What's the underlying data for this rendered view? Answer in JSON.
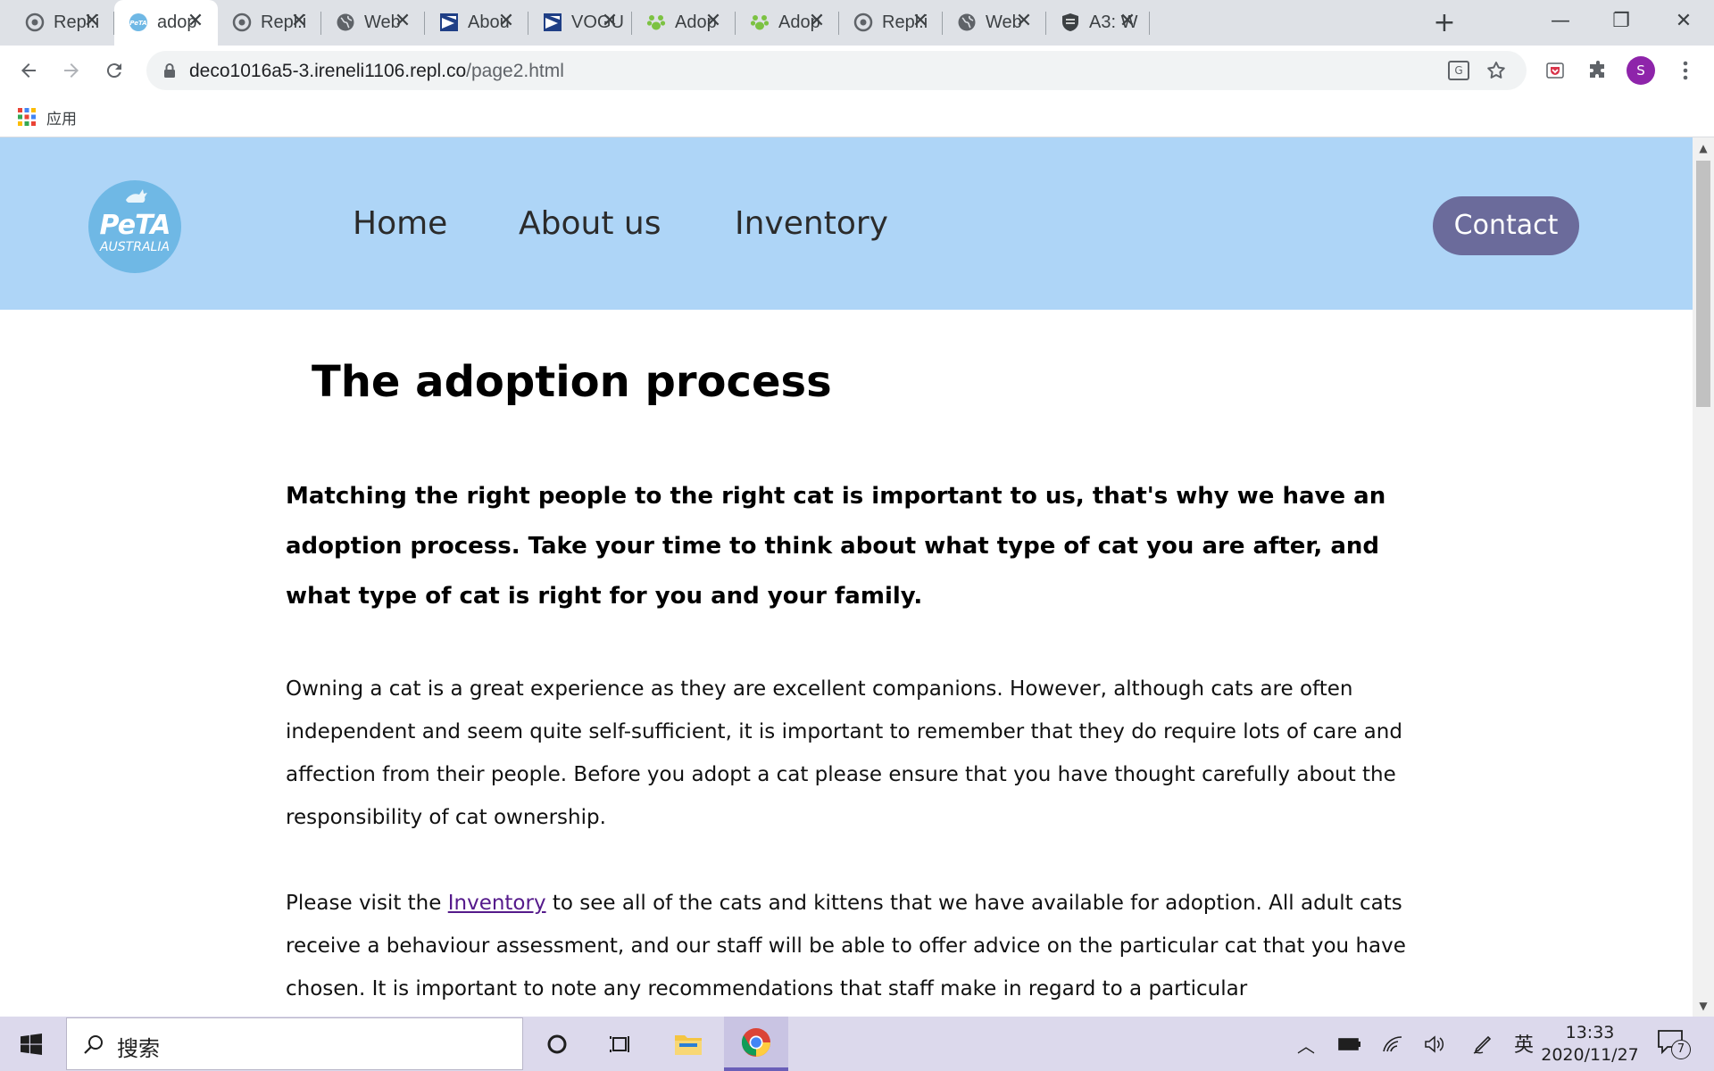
{
  "browser": {
    "tabs": [
      {
        "title": "Repl.i",
        "icon": "replit-icon"
      },
      {
        "title": "adop",
        "icon": "peta-icon",
        "active": true
      },
      {
        "title": "Repl.i",
        "icon": "replit-icon"
      },
      {
        "title": "Web",
        "icon": "globe-icon"
      },
      {
        "title": "Abou",
        "icon": "banner-icon"
      },
      {
        "title": "VOGU",
        "icon": "banner-icon"
      },
      {
        "title": "Adop",
        "icon": "paw-icon"
      },
      {
        "title": "Adop",
        "icon": "paw-icon"
      },
      {
        "title": "Repl.i",
        "icon": "replit-icon"
      },
      {
        "title": "Web",
        "icon": "globe-icon"
      },
      {
        "title": "A3: W",
        "icon": "shield-icon"
      }
    ],
    "url_host": "deco1016a5-3.ireneli1106.repl.co",
    "url_path": "/page2.html",
    "bookmarks_apps_label": "应用",
    "profile_initial": "S"
  },
  "site": {
    "logo_text": "PeTA",
    "logo_sub": "AUSTRALIA",
    "nav": {
      "home": "Home",
      "about": "About us",
      "inventory": "Inventory"
    },
    "contact": "Contact",
    "title": "The adoption process",
    "lead": "Matching the right people to the right cat is important to us, that's why we have an adoption process. Take your time to think about what type of cat you are after, and what type of cat is right for you and your family.",
    "para1": "Owning a cat is a great experience as they are excellent companions. However, although cats are often independent and seem quite self-sufficient, it is important to remember that they do require lots of care and affection from their people. Before you adopt a cat please ensure that you have thought carefully about the responsibility of cat ownership.",
    "para2_before": "Please visit the ",
    "para2_link": "Inventory",
    "para2_after": " to see all of the cats and kittens that we have available for adoption. All adult cats receive a behaviour assessment, and our staff will be able to offer advice on the particular cat that you have chosen. It is important to note any recommendations that staff make in regard to a particular"
  },
  "taskbar": {
    "search_placeholder": "搜索",
    "ime": "英",
    "time": "13:33",
    "date": "2020/11/27",
    "notification_count": "7"
  },
  "colors": {
    "header_bg": "#aed5f7",
    "contact_bg": "#6b6b9b",
    "link_visited": "#551a8b",
    "taskbar_bg": "#dcd9ec"
  }
}
